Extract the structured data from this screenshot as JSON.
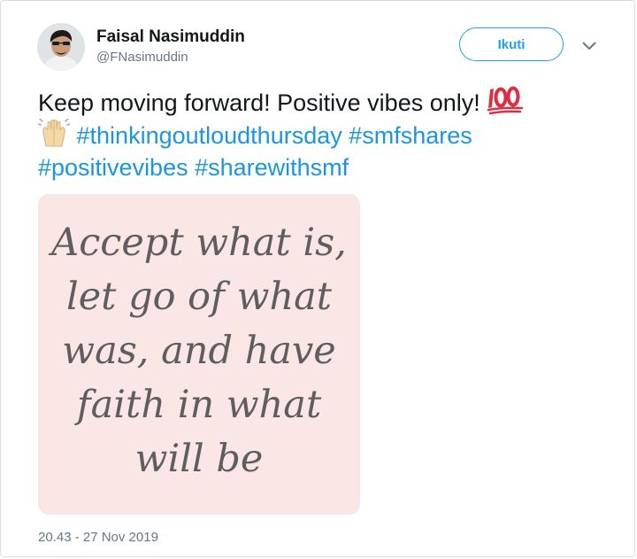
{
  "author": {
    "display_name": "Faisal Nasimuddin",
    "handle": "@FNasimuddin",
    "avatar_icon": "profile-photo-avatar"
  },
  "actions": {
    "follow_label": "Ikuti",
    "more_icon": "chevron-down-icon"
  },
  "tweet": {
    "text": "Keep moving forward! Positive vibes only!",
    "emojis": [
      "hundred-points-emoji",
      "raising-hands-emoji"
    ],
    "hashtags": [
      "#thinkingoutloudthursday",
      "#smfshares",
      "#positivevibes",
      "#sharewithsmf"
    ]
  },
  "media": {
    "quote_lines": [
      "Accept what is,",
      "let go of what",
      "was, and have",
      "faith in what",
      "will be"
    ],
    "background_color": "#fbe6e6",
    "text_color": "#5e5e5e"
  },
  "timestamp": "20.43 - 27 Nov 2019",
  "colors": {
    "accent": "#1da1f2",
    "hashtag": "#1b95e0",
    "secondary_text": "#657786"
  }
}
